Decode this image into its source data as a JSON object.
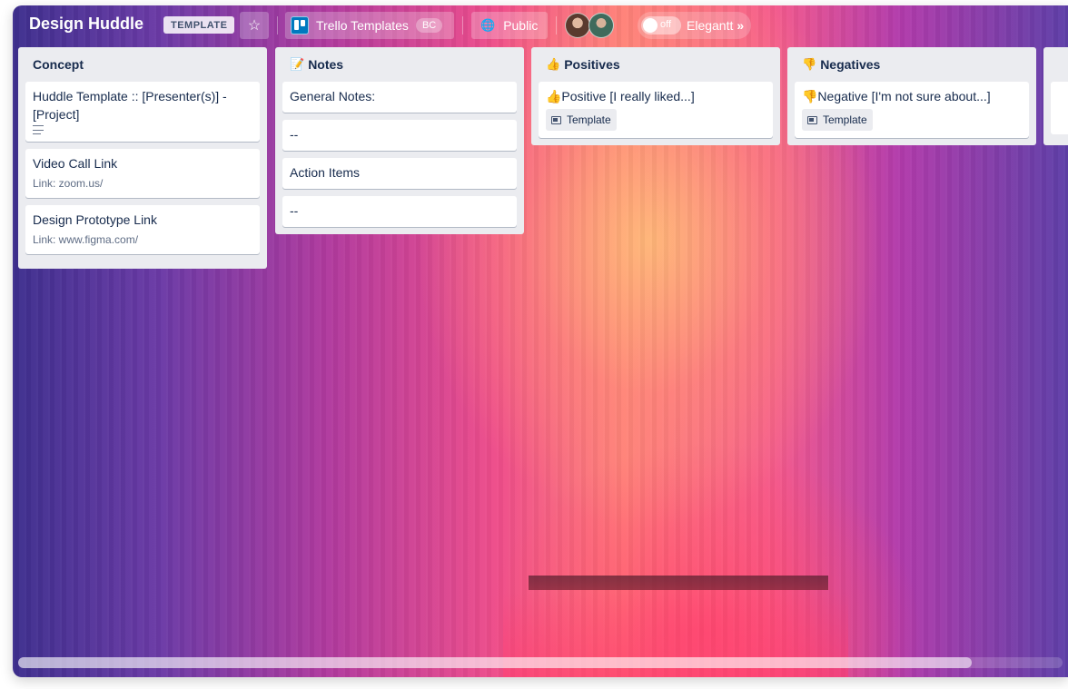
{
  "board": {
    "title": "Design Huddle",
    "badge": "TEMPLATE",
    "star_icon": "☆",
    "workspace": {
      "name": "Trello Templates",
      "tag": "BC"
    },
    "visibility": "Public",
    "toggle": {
      "state_label": "off",
      "name": "Elegantt",
      "chevron": "»"
    }
  },
  "lists": [
    {
      "title": "Concept",
      "cards": [
        {
          "title": "Huddle Template :: [Presenter(s)] - [Project]",
          "has_description_icon": true
        },
        {
          "title": "Video Call Link",
          "subtitle": "Link: zoom.us/"
        },
        {
          "title": "Design Prototype Link",
          "subtitle": "Link: www.figma.com/"
        }
      ]
    },
    {
      "title_emoji": "📝",
      "title": "Notes",
      "cards": [
        {
          "title": "General Notes:"
        },
        {
          "title": "--"
        },
        {
          "title": "Action Items"
        },
        {
          "title": "--"
        }
      ]
    },
    {
      "title_emoji": "👍",
      "title": "Positives",
      "cards": [
        {
          "title": "👍Positive [I really liked...]",
          "badge": "Template"
        }
      ]
    },
    {
      "title_emoji": "👎",
      "title": "Negatives",
      "cards": [
        {
          "title": "👎Negative [I'm not sure about...]",
          "badge": "Template"
        }
      ]
    }
  ],
  "icons": {
    "globe": "🌐",
    "star": "star-icon",
    "workspace": "trello-board-icon",
    "template": "template-card-icon",
    "description": "description-lines-icon"
  }
}
